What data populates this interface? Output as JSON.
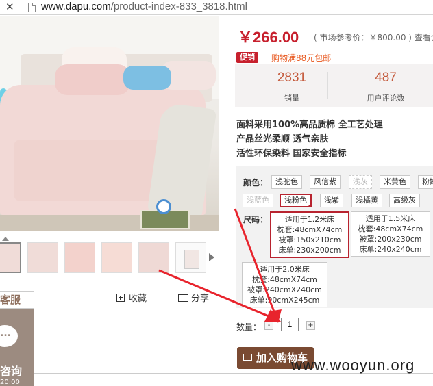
{
  "address_bar": {
    "url_host": "www.dapu.com",
    "url_path": "/product-index-833_3818.html"
  },
  "product": {
    "price": "￥266.00",
    "market_ref": "( 市场参考价：￥800.00 ) 查看会",
    "promo_tag": "促销",
    "promo_text": "购物满88元包邮",
    "stats": [
      {
        "value": "2831",
        "label": "销量"
      },
      {
        "value": "487",
        "label": "用户评论数"
      }
    ],
    "features": [
      "面料采用100%高品质棉 全工艺处理",
      "产品丝光柔顺 透气亲肤",
      "活性环保染料 国家安全指标"
    ]
  },
  "options": {
    "color_label": "颜色：",
    "colors_row1": [
      {
        "label": "浅驼色",
        "state": "normal"
      },
      {
        "label": "风信紫",
        "state": "normal"
      },
      {
        "label": "浅灰",
        "state": "disabled"
      },
      {
        "label": "米黄色",
        "state": "normal"
      },
      {
        "label": "粉嫩",
        "state": "normal"
      }
    ],
    "colors_row2": [
      {
        "label": "浅蓝色",
        "state": "disabled"
      },
      {
        "label": "浅粉色",
        "state": "selected"
      },
      {
        "label": "浅紫",
        "state": "normal"
      },
      {
        "label": "浅橘黄",
        "state": "normal"
      },
      {
        "label": "高级灰",
        "state": "normal"
      }
    ],
    "size_label": "尺码：",
    "sizes": [
      {
        "lines": [
          "适用于1.2米床",
          "枕套:48cmX74cm",
          "被罩:150x210cm",
          "床单:230x200cm"
        ],
        "state": "selected"
      },
      {
        "lines": [
          "适用于1.5米床",
          "枕套:48cmX74cm",
          "被罩:200x230cm",
          "床单:240x240cm"
        ],
        "state": "normal"
      },
      {
        "lines": [
          "适用于2.0米床",
          "枕套:48cmX74cm",
          "被罩:240cmX240cm",
          "床单:90cmX245cm"
        ],
        "state": "normal"
      }
    ]
  },
  "quantity": {
    "label": "数量：",
    "minus": "-",
    "value": "1",
    "plus": "+"
  },
  "actions": {
    "favorite": "收藏",
    "share": "分享",
    "add_to_cart": "加入购物车"
  },
  "service": {
    "header": "客服",
    "consult": "咨询",
    "hours": "20:00"
  },
  "watermark": "www.wooyun.org",
  "colors": {
    "price_red": "#c7202d",
    "cart_brown": "#7a4a32",
    "service_bg": "#9c8b80",
    "arrow_red": "#e8242d"
  }
}
